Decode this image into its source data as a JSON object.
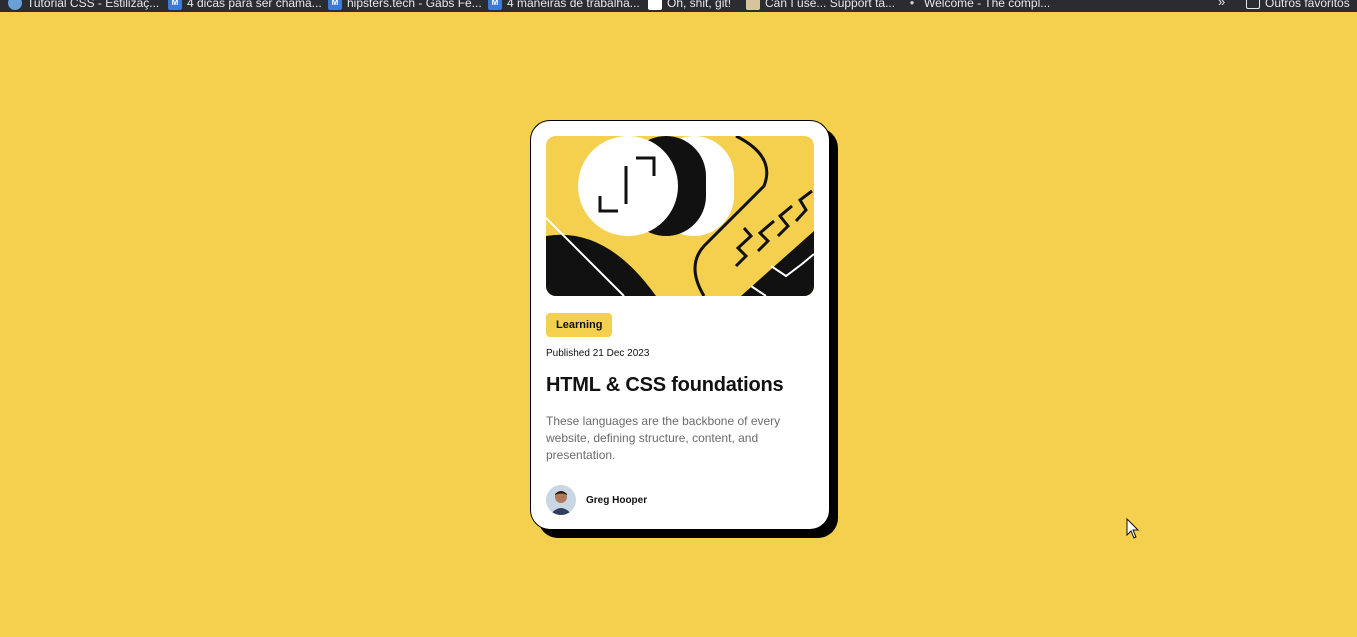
{
  "browser": {
    "bookmarks": [
      {
        "label": "Tutorial CSS - Estilizaç...",
        "icon": "globe-icon"
      },
      {
        "label": "4 dicas para ser chama...",
        "icon": "medium-icon"
      },
      {
        "label": "hipsters.tech - Gabs Fe...",
        "icon": "medium-icon"
      },
      {
        "label": "4 maneiras de trabalha...",
        "icon": "medium-icon"
      },
      {
        "label": "Oh, shit, git!",
        "icon": "git-icon"
      },
      {
        "label": "Can I use... Support ta...",
        "icon": "caniuse-icon"
      },
      {
        "label": "Welcome - The compl...",
        "icon": "chat-icon"
      }
    ],
    "more_label": "»",
    "other_bookmarks_label": "Outros favoritos"
  },
  "card": {
    "tag": "Learning",
    "published": "Published 21 Dec 2023",
    "title": "HTML & CSS foundations",
    "description": "These languages are the backbone of every website, defining structure, content, and presentation.",
    "author": {
      "name": "Greg Hooper"
    }
  },
  "colors": {
    "background": "#f4d04e",
    "card": "#ffffff",
    "text": "#111111",
    "muted": "#6b6b6b"
  }
}
